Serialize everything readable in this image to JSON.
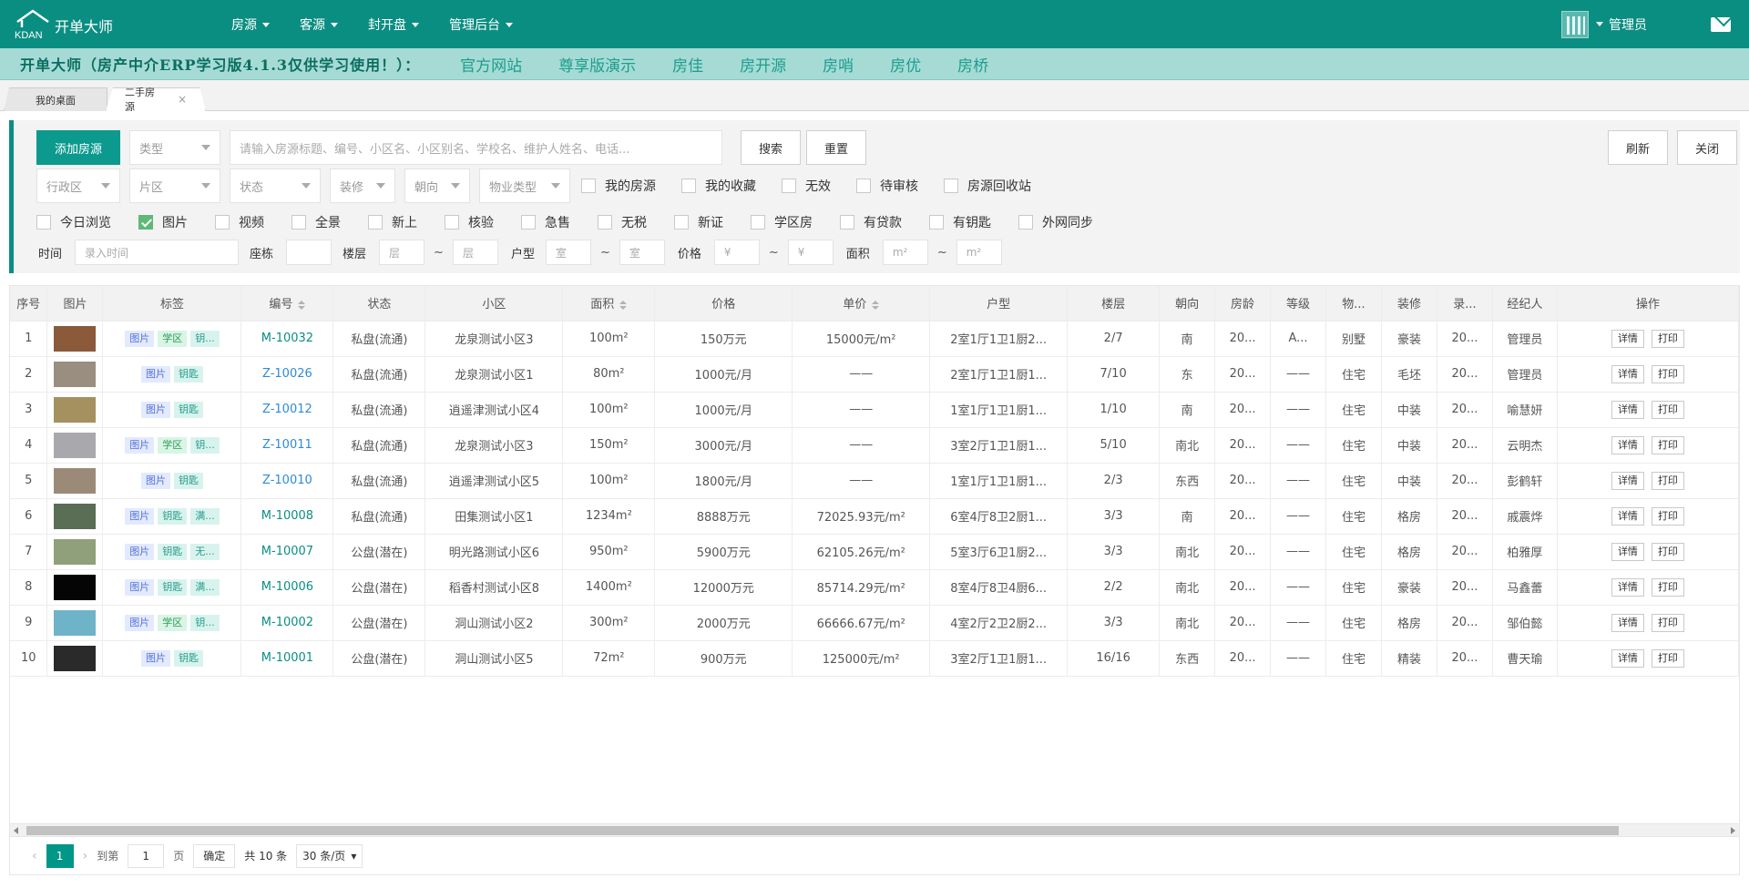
{
  "header": {
    "logo_text": "KDAN",
    "brand": "开单大师",
    "nav": [
      "房源",
      "客源",
      "封开盘",
      "管理后台"
    ],
    "admin": "管理员",
    "colors": {
      "primary": "#0b8e82",
      "banner": "#a6dbd5"
    }
  },
  "banner": {
    "title": "开单大师（房产中介ERP学习版4.1.3仅供学习使用！）：",
    "links": [
      "官方网站",
      "尊享版演示",
      "房佳",
      "房开源",
      "房哨",
      "房优",
      "房桥"
    ]
  },
  "tabs": [
    {
      "label": "我的桌面",
      "active": false
    },
    {
      "label": "二手房源",
      "active": true,
      "close": "×"
    }
  ],
  "filters": {
    "add_button": "添加房源",
    "type_select": "类型",
    "search_placeholder": "请输入房源标题、编号、小区名、小区别名、学校名、维护人姓名、电话...",
    "search_button": "搜索",
    "reset_button": "重置",
    "refresh_button": "刷新",
    "close_button": "关闭",
    "selects_row2": [
      "行政区",
      "片区",
      "状态",
      "装修",
      "朝向",
      "物业类型"
    ],
    "checks_row2": [
      {
        "label": "我的房源",
        "checked": false
      },
      {
        "label": "我的收藏",
        "checked": false
      },
      {
        "label": "无效",
        "checked": false
      },
      {
        "label": "待审核",
        "checked": false
      },
      {
        "label": "房源回收站",
        "checked": false
      }
    ],
    "checks_row3": [
      {
        "label": "今日浏览",
        "checked": false
      },
      {
        "label": "图片",
        "checked": true
      },
      {
        "label": "视频",
        "checked": false
      },
      {
        "label": "全景",
        "checked": false
      },
      {
        "label": "新上",
        "checked": false
      },
      {
        "label": "核验",
        "checked": false
      },
      {
        "label": "急售",
        "checked": false
      },
      {
        "label": "无税",
        "checked": false
      },
      {
        "label": "新证",
        "checked": false
      },
      {
        "label": "学区房",
        "checked": false
      },
      {
        "label": "有贷款",
        "checked": false
      },
      {
        "label": "有钥匙",
        "checked": false
      },
      {
        "label": "外网同步",
        "checked": false
      }
    ],
    "row4": {
      "time_label": "时间",
      "time_placeholder": "录入时间",
      "building_label": "座栋",
      "floor_label": "楼层",
      "floor_from": "层",
      "floor_to": "层",
      "layout_label": "户型",
      "layout_from": "室",
      "layout_to": "室",
      "price_label": "价格",
      "price_from": "¥",
      "price_to": "¥",
      "area_label": "面积",
      "area_from": "m²",
      "area_to": "m²",
      "tilde": "~"
    }
  },
  "table": {
    "columns": [
      "序号",
      "图片",
      "标签",
      "编号",
      "状态",
      "小区",
      "面积",
      "价格",
      "单价",
      "户型",
      "楼层",
      "朝向",
      "房龄",
      "等级",
      "物...",
      "装修",
      "录...",
      "经纪人",
      "操作"
    ],
    "op_labels": [
      "详情",
      "打印"
    ],
    "rows": [
      {
        "no": "1",
        "thumb": "#8a5a3a",
        "tags": [
          [
            "图片",
            "blue"
          ],
          [
            "学区",
            "green"
          ],
          [
            "钥...",
            "teal"
          ]
        ],
        "code": "M-10032",
        "code_color": "teal",
        "status": "私盘(流通)",
        "community": "龙泉测试小区3",
        "area": "100m²",
        "price": "150万元",
        "unit": "15000元/m²",
        "layout": "2室1厅1卫1厨2...",
        "floor": "2/7",
        "orient": "南",
        "age": "20...",
        "grade": "A...",
        "prop": "别墅",
        "deco": "豪装",
        "entry": "20...",
        "agent": "管理员"
      },
      {
        "no": "2",
        "thumb": "#9a8e80",
        "tags": [
          [
            "图片",
            "blue"
          ],
          [
            "钥匙",
            "teal"
          ]
        ],
        "code": "Z-10026",
        "code_color": "blue",
        "status": "私盘(流通)",
        "community": "龙泉测试小区1",
        "area": "80m²",
        "price": "1000元/月",
        "unit": "——",
        "layout": "2室1厅1卫1厨1...",
        "floor": "7/10",
        "orient": "东",
        "age": "20...",
        "grade": "——",
        "prop": "住宅",
        "deco": "毛坯",
        "entry": "20...",
        "agent": "管理员"
      },
      {
        "no": "3",
        "thumb": "#a5905f",
        "tags": [
          [
            "图片",
            "blue"
          ],
          [
            "钥匙",
            "teal"
          ]
        ],
        "code": "Z-10012",
        "code_color": "blue",
        "status": "私盘(流通)",
        "community": "逍遥津测试小区4",
        "area": "100m²",
        "price": "1000元/月",
        "unit": "——",
        "layout": "1室1厅1卫1厨1...",
        "floor": "1/10",
        "orient": "南",
        "age": "20...",
        "grade": "——",
        "prop": "住宅",
        "deco": "中装",
        "entry": "20...",
        "agent": "喻慧妍"
      },
      {
        "no": "4",
        "thumb": "#a8a8ad",
        "tags": [
          [
            "图片",
            "blue"
          ],
          [
            "学区",
            "green"
          ],
          [
            "钥...",
            "teal"
          ]
        ],
        "code": "Z-10011",
        "code_color": "blue",
        "status": "私盘(流通)",
        "community": "龙泉测试小区3",
        "area": "150m²",
        "price": "3000元/月",
        "unit": "——",
        "layout": "3室2厅1卫1厨1...",
        "floor": "5/10",
        "orient": "南北",
        "age": "20...",
        "grade": "——",
        "prop": "住宅",
        "deco": "中装",
        "entry": "20...",
        "agent": "云明杰"
      },
      {
        "no": "5",
        "thumb": "#9c8a78",
        "tags": [
          [
            "图片",
            "blue"
          ],
          [
            "钥匙",
            "teal"
          ]
        ],
        "code": "Z-10010",
        "code_color": "blue",
        "status": "私盘(流通)",
        "community": "逍遥津测试小区5",
        "area": "100m²",
        "price": "1800元/月",
        "unit": "——",
        "layout": "1室1厅1卫1厨1...",
        "floor": "2/3",
        "orient": "东西",
        "age": "20...",
        "grade": "——",
        "prop": "住宅",
        "deco": "中装",
        "entry": "20...",
        "agent": "彭鹤轩"
      },
      {
        "no": "6",
        "thumb": "#5a6d55",
        "tags": [
          [
            "图片",
            "blue"
          ],
          [
            "钥匙",
            "teal"
          ],
          [
            "满...",
            "teal"
          ]
        ],
        "code": "M-10008",
        "code_color": "teal",
        "status": "私盘(流通)",
        "community": "田集测试小区1",
        "area": "1234m²",
        "price": "8888万元",
        "unit": "72025.93元/m²",
        "layout": "6室4厅8卫2厨1...",
        "floor": "3/3",
        "orient": "南",
        "age": "20...",
        "grade": "——",
        "prop": "住宅",
        "deco": "格房",
        "entry": "20...",
        "agent": "戚震烨"
      },
      {
        "no": "7",
        "thumb": "#8fa07a",
        "tags": [
          [
            "图片",
            "blue"
          ],
          [
            "钥匙",
            "teal"
          ],
          [
            "无...",
            "teal"
          ]
        ],
        "code": "M-10007",
        "code_color": "teal",
        "status": "公盘(潜在)",
        "community": "明光路测试小区6",
        "area": "950m²",
        "price": "5900万元",
        "unit": "62105.26元/m²",
        "layout": "5室3厅6卫1厨2...",
        "floor": "3/3",
        "orient": "南北",
        "age": "20...",
        "grade": "——",
        "prop": "住宅",
        "deco": "格房",
        "entry": "20...",
        "agent": "柏雅厚"
      },
      {
        "no": "8",
        "thumb": "#050505",
        "tags": [
          [
            "图片",
            "blue"
          ],
          [
            "钥匙",
            "teal"
          ],
          [
            "满...",
            "teal"
          ]
        ],
        "code": "M-10006",
        "code_color": "teal",
        "status": "公盘(潜在)",
        "community": "稻香村测试小区8",
        "area": "1400m²",
        "price": "12000万元",
        "unit": "85714.29元/m²",
        "layout": "8室4厅8卫4厨6...",
        "floor": "2/2",
        "orient": "南北",
        "age": "20...",
        "grade": "——",
        "prop": "住宅",
        "deco": "豪装",
        "entry": "20...",
        "agent": "马鑫蕾"
      },
      {
        "no": "9",
        "thumb": "#6fb3c9",
        "tags": [
          [
            "图片",
            "blue"
          ],
          [
            "学区",
            "green"
          ],
          [
            "钥...",
            "teal"
          ]
        ],
        "code": "M-10002",
        "code_color": "teal",
        "status": "公盘(潜在)",
        "community": "洞山测试小区2",
        "area": "300m²",
        "price": "2000万元",
        "unit": "66666.67元/m²",
        "layout": "4室2厅2卫2厨2...",
        "floor": "3/3",
        "orient": "南北",
        "age": "20...",
        "grade": "——",
        "prop": "住宅",
        "deco": "格房",
        "entry": "20...",
        "agent": "邹伯懿"
      },
      {
        "no": "10",
        "thumb": "#2a2a2a",
        "tags": [
          [
            "图片",
            "blue"
          ],
          [
            "钥匙",
            "teal"
          ]
        ],
        "code": "M-10001",
        "code_color": "teal",
        "status": "公盘(潜在)",
        "community": "洞山测试小区5",
        "area": "72m²",
        "price": "900万元",
        "unit": "125000元/m²",
        "layout": "3室2厅1卫1厨1...",
        "floor": "16/16",
        "orient": "东西",
        "age": "20...",
        "grade": "——",
        "prop": "住宅",
        "deco": "精装",
        "entry": "20...",
        "agent": "曹天瑜"
      }
    ]
  },
  "pager": {
    "current": "1",
    "goto_label": "到第",
    "goto_value": "1",
    "page_label": "页",
    "confirm": "确定",
    "total": "共 10 条",
    "per_page": "30 条/页"
  }
}
